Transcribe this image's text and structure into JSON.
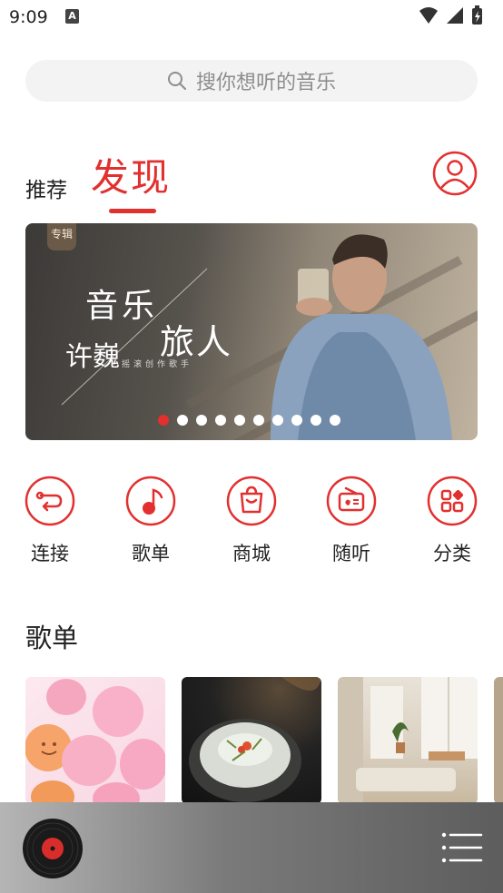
{
  "status_bar": {
    "time": "9:09",
    "notification_icon": "A",
    "icons": [
      "wifi-icon",
      "signal-icon",
      "battery-icon"
    ]
  },
  "search": {
    "placeholder": "搜你想听的音乐",
    "icon": "search-icon"
  },
  "tabs": {
    "recommend": "推荐",
    "discover": "发现",
    "active": "discover"
  },
  "profile": {
    "icon": "user-icon"
  },
  "banner": {
    "tag": "专辑",
    "title_line1": "音乐",
    "title_line2": "旅人",
    "artist": "许巍",
    "subtitle": "摇滚创作歌手",
    "dot_count": 10,
    "active_dot": 0
  },
  "quick_nav": [
    {
      "label": "连接",
      "icon": "connect-icon"
    },
    {
      "label": "歌单",
      "icon": "music-note-icon"
    },
    {
      "label": "商城",
      "icon": "shopping-bag-icon"
    },
    {
      "label": "随听",
      "icon": "radio-icon"
    },
    {
      "label": "分类",
      "icon": "category-grid-icon"
    }
  ],
  "playlists": {
    "title": "歌单",
    "items": [
      {
        "cover": "balloons"
      },
      {
        "cover": "food-bowl"
      },
      {
        "cover": "bright-room"
      },
      {
        "cover": "partial"
      }
    ]
  },
  "player": {
    "disc_icon": "vinyl-record-icon",
    "menu_icon": "playlist-menu-icon"
  },
  "colors": {
    "accent": "#e2302f",
    "text": "#222222",
    "search_bg": "#f3f3f3",
    "placeholder": "#8d8d8d"
  }
}
